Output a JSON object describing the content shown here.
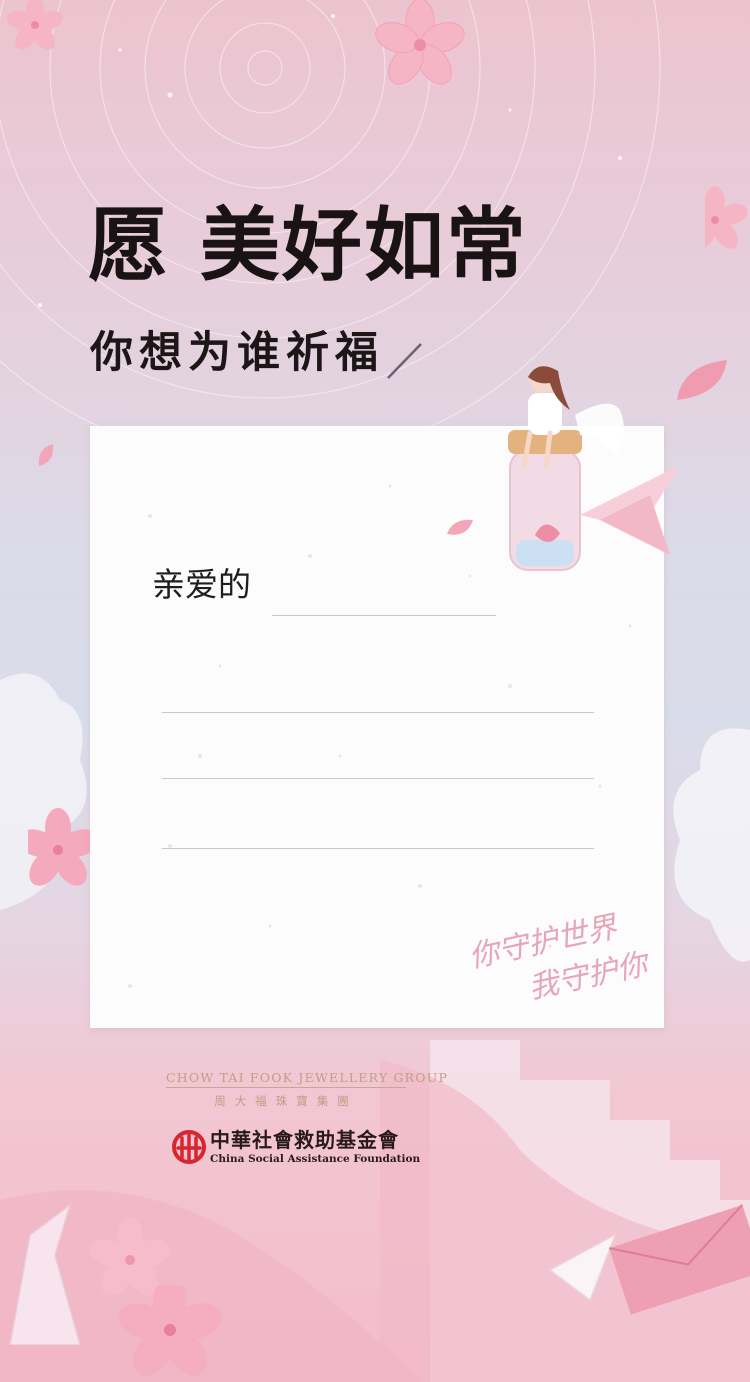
{
  "poster": {
    "title": "愿 美好如常",
    "subtitle": "你想为谁祈福"
  },
  "letter": {
    "salutation": "亲爱的",
    "slogan_line1": "你守护世界",
    "slogan_line2": "我守护你"
  },
  "sponsors": {
    "ctf_english": "CHOW TAI FOOK JEWELLERY GROUP",
    "ctf_chinese": "周大福珠寶集團",
    "csaf_chinese": "中華社會救助基金會",
    "csaf_english": "China Social Assistance Foundation"
  },
  "colors": {
    "title": "#1a1314",
    "petal": "#f4aec0",
    "card": "#fdfcfc",
    "slogan": "#e7a5b8",
    "csaf_red": "#d7262f"
  },
  "icons": [
    "sakura-flower-icon",
    "petal-icon",
    "girl-on-bottle-illustration",
    "paper-crane-icon",
    "envelope-icon",
    "csaf-logo-icon"
  ]
}
